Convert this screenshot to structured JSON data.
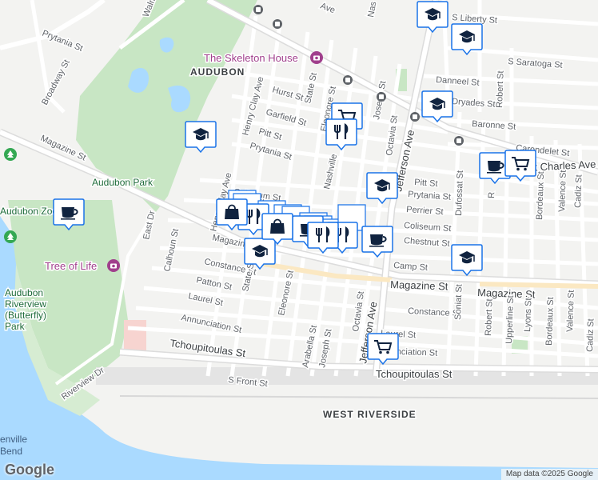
{
  "map": {
    "streets": {
      "prytania_nw": "Prytania St",
      "broadway": "Broadway St",
      "magazine_w": "Magazine St",
      "east_dr": "East Dr",
      "calhoun": "Calhoun St",
      "henry_clay": "Henry Clay Ave",
      "henry_clay_n": "Henry Clay Ave",
      "hurst": "Hurst St",
      "state": "State St",
      "state_s": "State St",
      "garfield": "Garfield St",
      "pitt_n": "Pitt St",
      "prytania": "Prytania St",
      "coliseum": "Coliseum St",
      "chestnut_w": "Chestnut St",
      "magazine_mid": "Magazine",
      "constance_w": "Constance St",
      "patton": "Patton St",
      "laurel_w": "Laurel St",
      "annunciation_w": "Annunciation St",
      "tchoupitoulas_w": "Tchoupitoulas St",
      "s_front": "S Front St",
      "riverview": "Riverview Dr",
      "eleonore_n": "Eleonore St",
      "eleonore_s": "Eleonore St",
      "nashville": "Nashville",
      "joseph_n": "Joseph St",
      "joseph_s": "Joseph St",
      "octavia_n": "Octavia St",
      "octavia_s": "Octavia St",
      "jefferson_n": "Jefferson Ave",
      "jefferson_s": "Jefferson Ave",
      "arabella": "Arabella St",
      "laurel_e": "Laurel St",
      "annunciation_e": "Annunciation St",
      "tchoupitoulas_e": "Tchoupitoulas St",
      "constance_e": "Constance St",
      "magazine_e1": "Magazine St",
      "magazine_e2": "Magazine St",
      "camp": "Camp St",
      "chestnut_e": "Chestnut St",
      "coliseum_e": "Coliseum St",
      "perrier": "Perrier St",
      "prytania_e": "Prytania St",
      "pitt_e": "Pitt St",
      "st_charles": "St Charles Ave",
      "carondelet": "Carondelet St",
      "baronne": "Baronne St",
      "dryades": "Dryades St",
      "danneel": "Danneel St",
      "s_saratoga": "S Saratoga St",
      "s_liberty": "S Liberty St",
      "dufossat": "Dufossat St",
      "sonjat": "Soniat St",
      "robert_n": "Robert St",
      "robert_s": "Robert St",
      "upperline": "Upperline St",
      "lyons": "Lyons St",
      "bordeaux_n": "Bordeaux St",
      "bordeaux_s": "Bordeaux St",
      "valence_n": "Valence St",
      "valence_s": "Valence St",
      "cadiz_n": "Cadiz St",
      "cadiz_s": "Cadiz St",
      "walmsley": "Walmsley",
      "ave_top": "Ave",
      "nashville_top": "Nas",
      "r_frag": "R",
      "st_frag": "St",
      "st_frag2": "St"
    },
    "areas": {
      "audubon": "AUDUBON",
      "west_riverside": "WEST RIVERSIDE",
      "audubon_park": "Audubon Park",
      "audubon_zoo": "Audubon Zoo",
      "riverview_park_1": "Audubon",
      "riverview_park_2": "Riverview",
      "riverview_park_3": "(Butterfly)",
      "riverview_park_4": "Park",
      "bend_1": "enville",
      "bend_2": "Bend"
    },
    "pois": {
      "skeleton_house": "The Skeleton House",
      "tree_of_life": "Tree of Life"
    },
    "colors": {
      "water": "#aadaff",
      "park": "#c8e6c4",
      "road": "#ffffff",
      "arterial": "#dddddd",
      "marker_fill": "#ffffff",
      "marker_border": "#1a73e8",
      "marker_icon": "#10233f",
      "poi_accent": "#a03f8c",
      "park_text": "#1e6b3a"
    },
    "markers": [
      {
        "type": "school",
        "icon": "graduation-cap-icon"
      },
      {
        "type": "school",
        "icon": "graduation-cap-icon"
      },
      {
        "type": "school",
        "icon": "graduation-cap-icon"
      },
      {
        "type": "school",
        "icon": "graduation-cap-icon"
      },
      {
        "type": "school",
        "icon": "graduation-cap-icon"
      },
      {
        "type": "school",
        "icon": "graduation-cap-icon"
      },
      {
        "type": "school",
        "icon": "graduation-cap-icon"
      },
      {
        "type": "cafe",
        "icon": "coffee-cup-icon"
      },
      {
        "type": "cafe",
        "icon": "coffee-cup-icon"
      },
      {
        "type": "cafe",
        "icon": "coffee-cup-icon"
      },
      {
        "type": "cafe",
        "icon": "coffee-cup-icon"
      },
      {
        "type": "grocery",
        "icon": "shopping-cart-icon"
      },
      {
        "type": "grocery",
        "icon": "shopping-cart-icon"
      },
      {
        "type": "grocery",
        "icon": "shopping-cart-icon"
      },
      {
        "type": "restaurant",
        "icon": "fork-knife-icon"
      },
      {
        "type": "restaurant",
        "icon": "fork-knife-icon"
      },
      {
        "type": "restaurant",
        "icon": "fork-knife-icon"
      },
      {
        "type": "restaurant",
        "icon": "fork-knife-icon"
      },
      {
        "type": "shopping",
        "icon": "shopping-bag-icon"
      },
      {
        "type": "shopping",
        "icon": "shopping-bag-icon"
      }
    ],
    "google_logo": "Google",
    "attribution": "Map data ©2025 Google"
  }
}
